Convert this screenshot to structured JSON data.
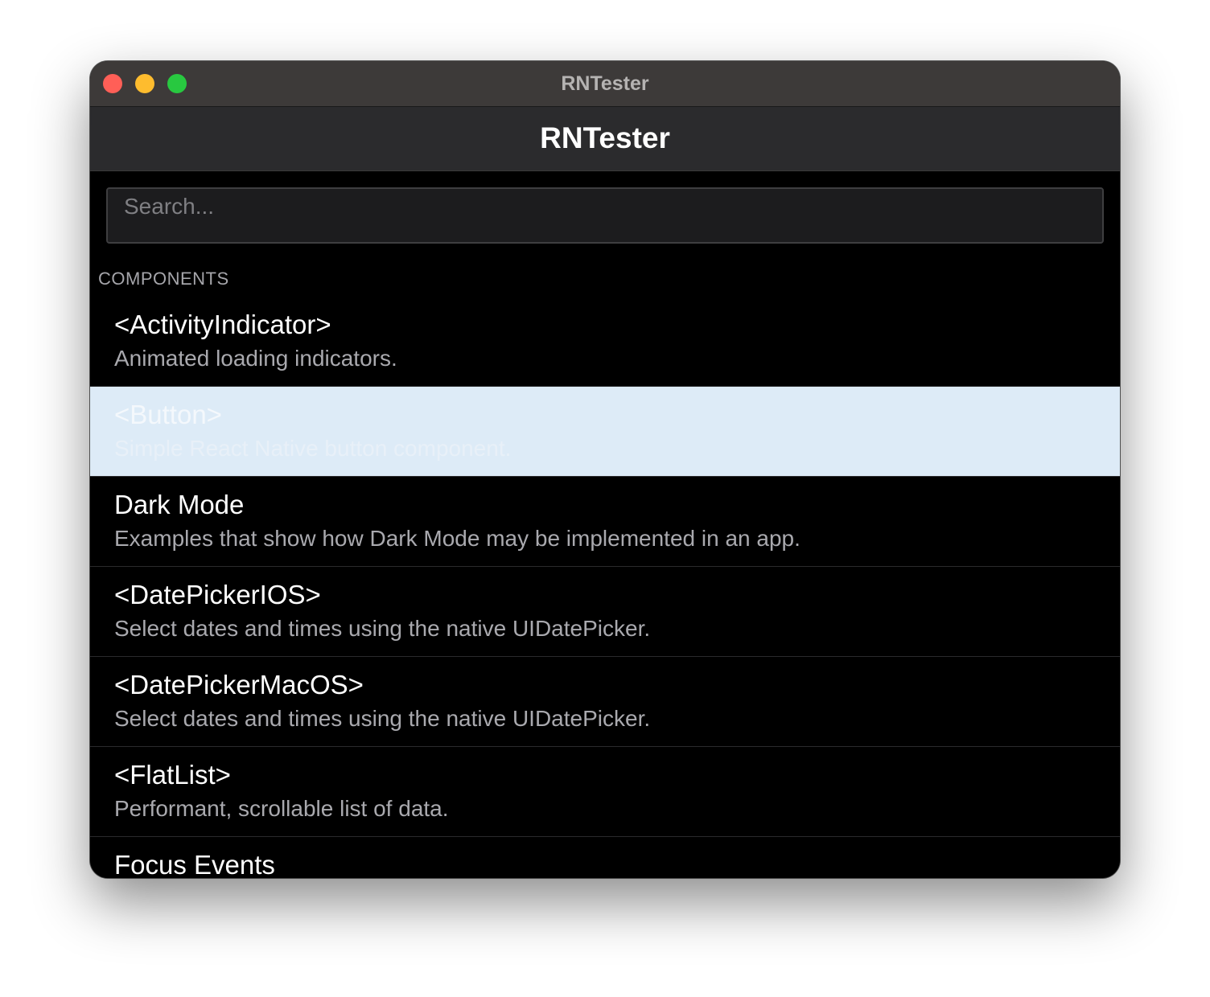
{
  "window": {
    "title": "RNTester"
  },
  "navbar": {
    "title": "RNTester"
  },
  "search": {
    "placeholder": "Search...",
    "value": ""
  },
  "section": {
    "header": "COMPONENTS"
  },
  "items": [
    {
      "title": "<ActivityIndicator>",
      "description": "Animated loading indicators.",
      "selected": false
    },
    {
      "title": "<Button>",
      "description": "Simple React Native button component.",
      "selected": true
    },
    {
      "title": "Dark Mode",
      "description": "Examples that show how Dark Mode may be implemented in an app.",
      "selected": false
    },
    {
      "title": "<DatePickerIOS>",
      "description": "Select dates and times using the native UIDatePicker.",
      "selected": false
    },
    {
      "title": "<DatePickerMacOS>",
      "description": "Select dates and times using the native UIDatePicker.",
      "selected": false
    },
    {
      "title": "<FlatList>",
      "description": "Performant, scrollable list of data.",
      "selected": false
    },
    {
      "title": "Focus Events",
      "description": "",
      "selected": false
    }
  ],
  "colors": {
    "selection": "#ddebf7",
    "titlebar": "#3d3a39",
    "navbar": "#2b2b2d",
    "close": "#ff5f57",
    "minimize": "#febc2e",
    "maximize": "#28c840"
  }
}
